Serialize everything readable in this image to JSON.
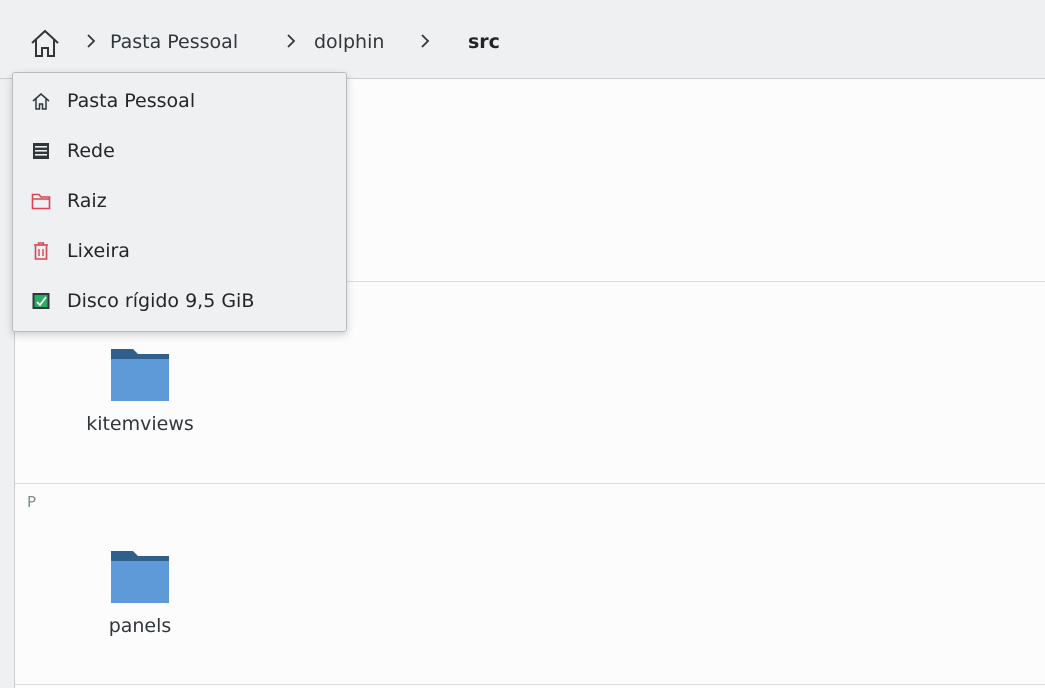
{
  "breadcrumb": {
    "home_icon": "home-icon",
    "items": [
      {
        "label": "Pasta Pessoal"
      },
      {
        "label": "dolphin"
      },
      {
        "label": "src"
      }
    ]
  },
  "places_menu": {
    "items": [
      {
        "label": "Pasta Pessoal",
        "icon": "home-icon"
      },
      {
        "label": "Rede",
        "icon": "network-icon"
      },
      {
        "label": "Raiz",
        "icon": "root-folder-icon",
        "color": "#da4453"
      },
      {
        "label": "Lixeira",
        "icon": "trash-icon",
        "color": "#da4453"
      },
      {
        "label": "Disco rígido 9,5 GiB",
        "icon": "hard-disk-icon",
        "color": "#27ae60"
      }
    ]
  },
  "file_view": {
    "groups": [
      {
        "letter": "",
        "items": [
          {
            "name": "kitemviews",
            "icon": "folder-icon"
          }
        ]
      },
      {
        "letter": "P",
        "items": [
          {
            "name": "panels",
            "icon": "folder-icon"
          }
        ]
      }
    ]
  },
  "colors": {
    "folder_body": "#5e9ad8",
    "folder_tab": "#2f5f8a",
    "background": "#fcfcfc",
    "toolbar": "#eff0f1"
  }
}
